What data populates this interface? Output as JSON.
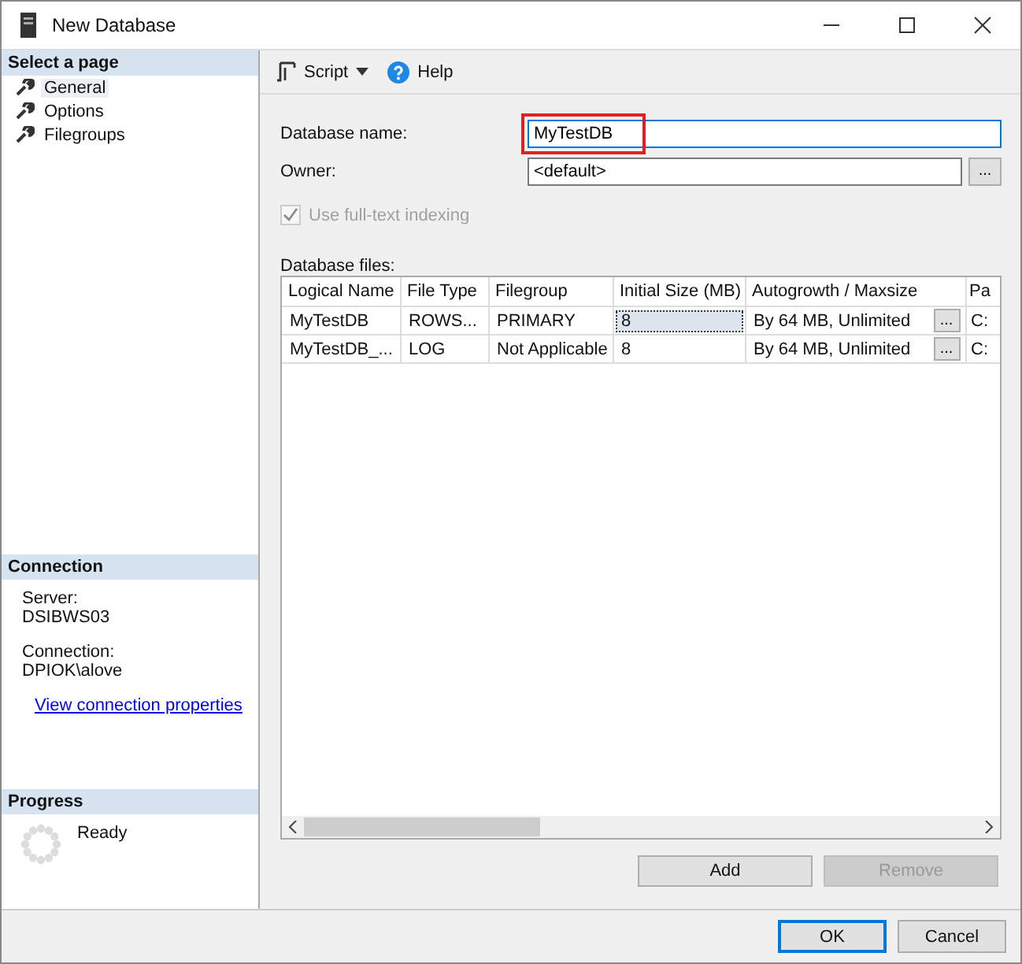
{
  "window": {
    "title": "New Database"
  },
  "sidebar": {
    "header": "Select a page",
    "items": [
      {
        "label": "General",
        "selected": true
      },
      {
        "label": "Options",
        "selected": false
      },
      {
        "label": "Filegroups",
        "selected": false
      }
    ]
  },
  "connection": {
    "header": "Connection",
    "server_label": "Server:",
    "server": "DSIBWS03",
    "connection_label": "Connection:",
    "connection": "DPIOK\\alove",
    "link": "View connection properties"
  },
  "progress": {
    "header": "Progress",
    "status": "Ready"
  },
  "toolbar": {
    "script": "Script",
    "help": "Help"
  },
  "form": {
    "name_label": "Database name:",
    "name_value": "MyTestDB",
    "name_highlighted": true,
    "owner_label": "Owner:",
    "owner_value": "<default>",
    "browse": "...",
    "fulltext": {
      "label": "Use full-text indexing",
      "checked": true,
      "disabled": true
    }
  },
  "files": {
    "label": "Database files:",
    "columns": [
      {
        "label": "Logical Name",
        "kind": "text"
      },
      {
        "label": "File Type",
        "kind": "text"
      },
      {
        "label": "Filegroup",
        "kind": "text"
      },
      {
        "label": "Initial Size (MB)",
        "kind": "text"
      },
      {
        "label": "Autogrowth / Maxsize",
        "kind": "browse"
      },
      {
        "label": "Pa",
        "kind": "text"
      }
    ],
    "rows": [
      [
        {
          "text": "MyTestDB",
          "selected": false
        },
        {
          "text": "ROWS...",
          "selected": false
        },
        {
          "text": "PRIMARY",
          "selected": false
        },
        {
          "text": "8",
          "selected": true
        },
        {
          "text": "By 64 MB, Unlimited",
          "selected": false
        },
        {
          "text": "C:",
          "selected": false
        }
      ],
      [
        {
          "text": "MyTestDB_...",
          "selected": false
        },
        {
          "text": "LOG",
          "selected": false
        },
        {
          "text": "Not Applicable",
          "selected": false
        },
        {
          "text": "8",
          "selected": false
        },
        {
          "text": "By 64 MB, Unlimited",
          "selected": false
        },
        {
          "text": "C:",
          "selected": false
        }
      ]
    ],
    "browse": "...",
    "buttons": [
      {
        "label": "Add",
        "disabled": false
      },
      {
        "label": "Remove",
        "disabled": true
      }
    ]
  },
  "footer": {
    "buttons": [
      {
        "label": "OK",
        "default": true
      },
      {
        "label": "Cancel",
        "default": false
      }
    ]
  }
}
